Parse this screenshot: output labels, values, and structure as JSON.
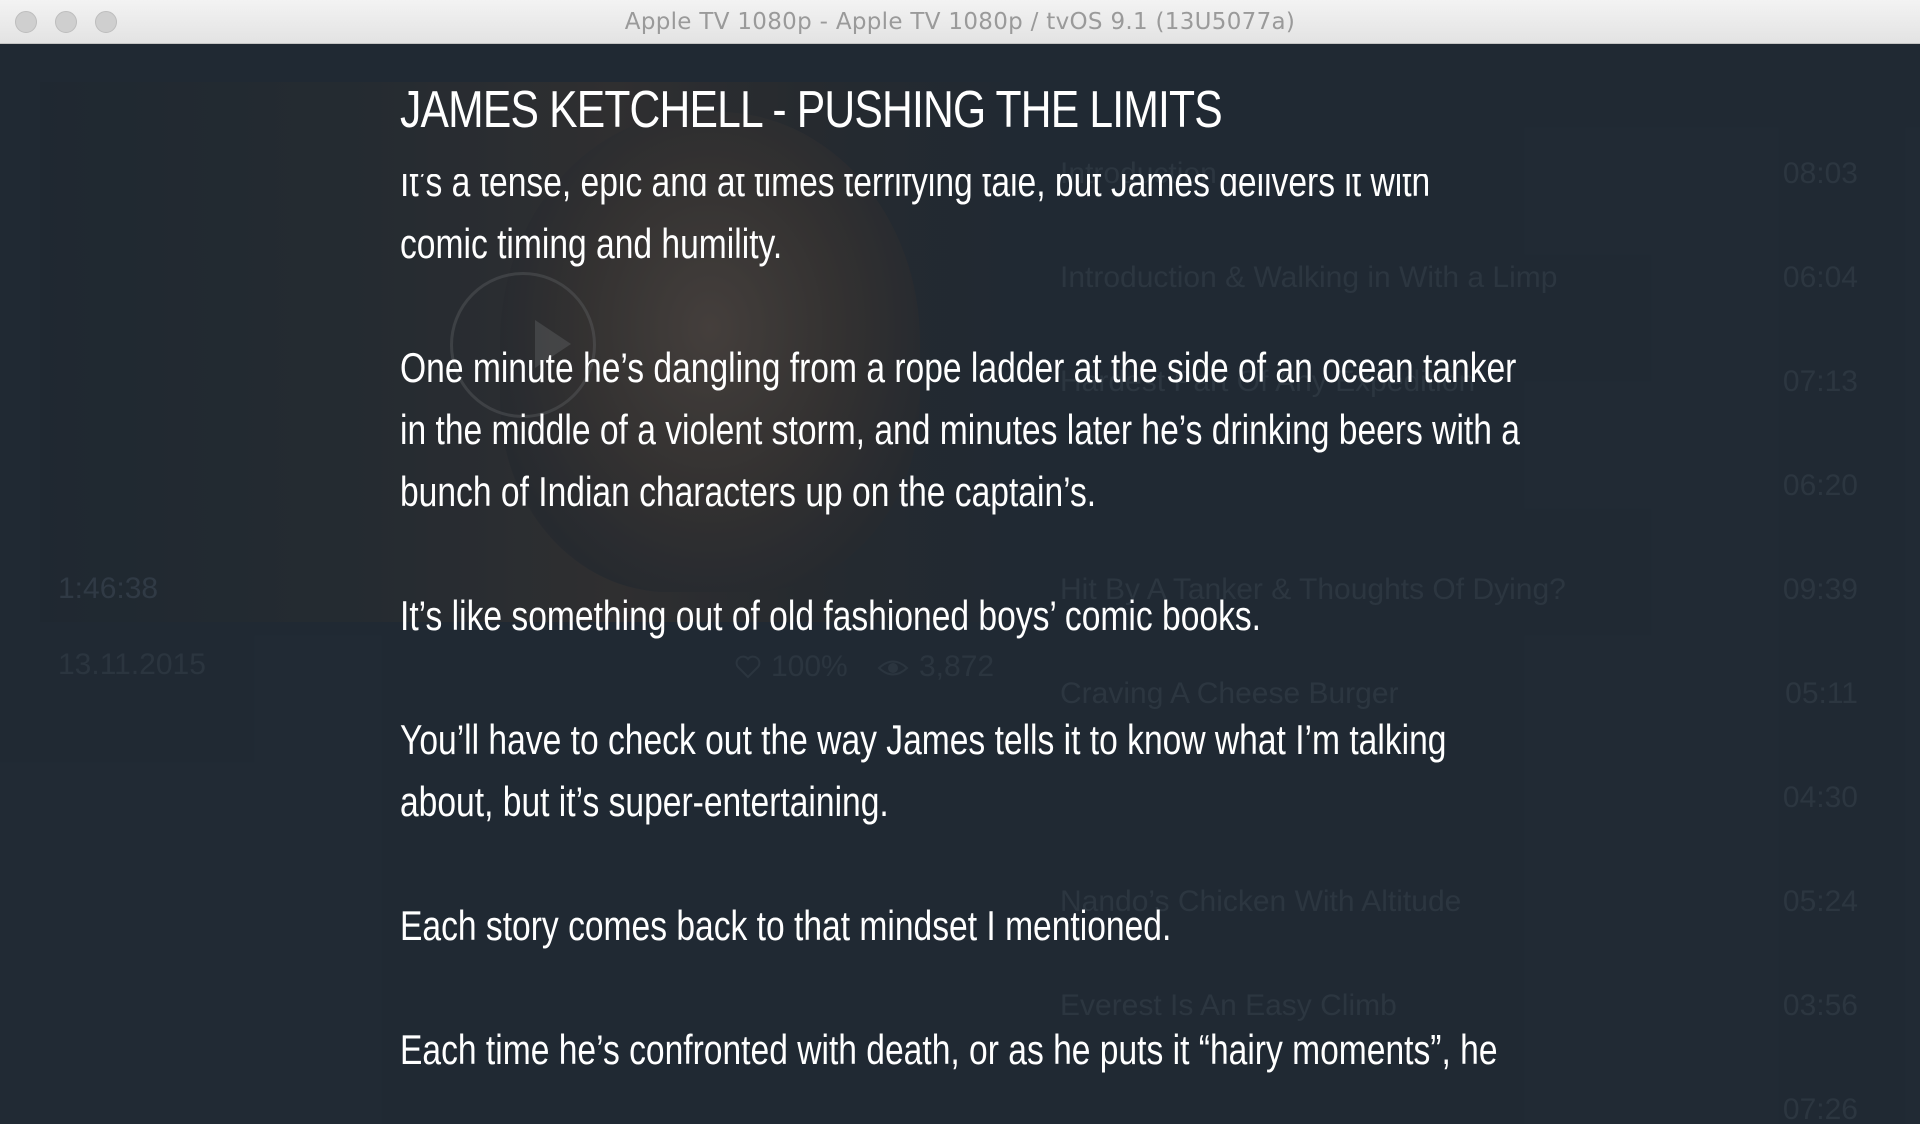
{
  "window": {
    "title": "Apple TV 1080p - Apple TV 1080p / tvOS 9.1 (13U5077a)"
  },
  "video": {
    "duration": "1:46:38",
    "date": "13.11.2015",
    "likes": "100%",
    "views": "3,872"
  },
  "chapters": [
    {
      "title": "Introduction",
      "time": "08:03"
    },
    {
      "title": "Introduction & Walking in With a Limp",
      "time": "06:04"
    },
    {
      "title": "Hardest Part Of Any Expedition",
      "time": "07:13"
    },
    {
      "title": "",
      "time": "06:20"
    },
    {
      "title": "Hit By A Tanker & Thoughts Of Dying?",
      "time": "09:39"
    },
    {
      "title": "Craving A Cheese Burger",
      "time": "05:11"
    },
    {
      "title": "",
      "time": "04:30"
    },
    {
      "title": "Nando’s Chicken With Altitude",
      "time": "05:24"
    },
    {
      "title": "Everest Is An Easy Climb",
      "time": "03:56"
    },
    {
      "title": "",
      "time": "07:26"
    }
  ],
  "detail": {
    "title": "JAMES KETCHELL - PUSHING THE LIMITS",
    "paragraphs": [
      "It’s a tense, epic and at times terrifying tale, but James delivers it with comic timing and humility.",
      "One minute he’s dangling from a rope ladder at the side of an ocean tanker in the middle of a violent storm, and minutes later he’s drinking beers with a bunch of Indian characters up on the captain’s.",
      "It’s like something out of old fashioned boys’ comic books.",
      "You’ll have to check out the way James tells it to know what I’m talking about, but it’s super-entertaining.",
      "Each story comes back to that mindset I mentioned.",
      "Each time he’s confronted with death, or as he puts it “hairy moments”, he"
    ]
  }
}
